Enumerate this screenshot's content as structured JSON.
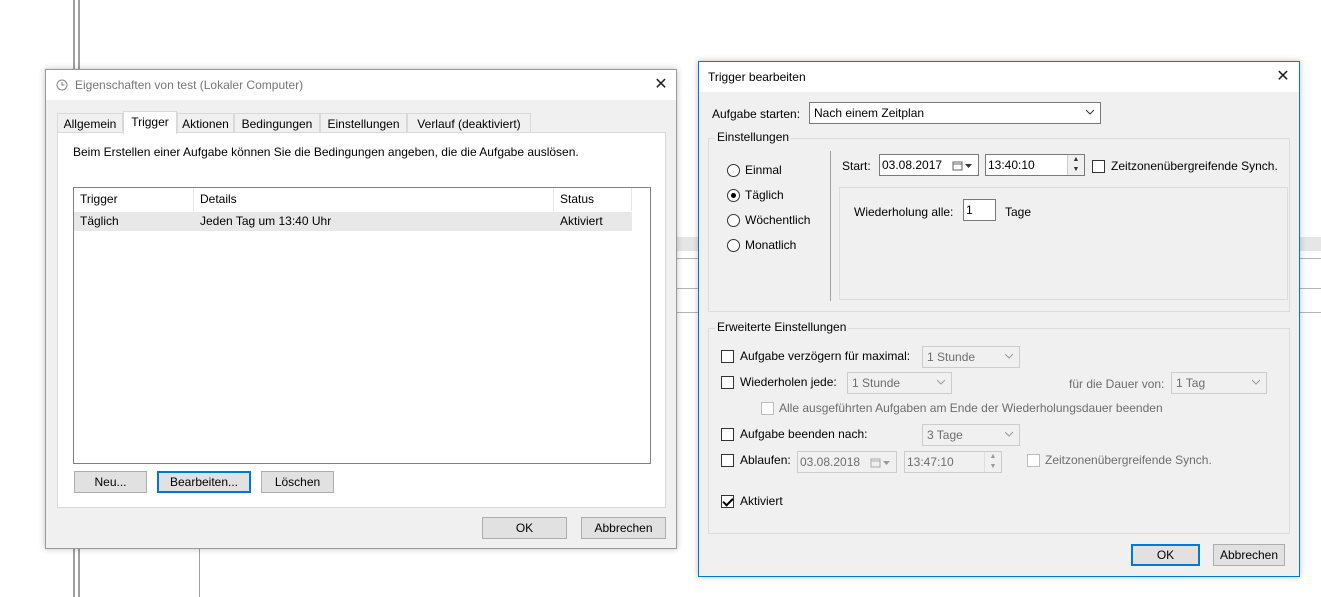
{
  "props_dialog": {
    "title": "Eigenschaften von test (Lokaler Computer)",
    "tabs": [
      "Allgemein",
      "Trigger",
      "Aktionen",
      "Bedingungen",
      "Einstellungen",
      "Verlauf (deaktiviert)"
    ],
    "active_tab": "Trigger",
    "description": "Beim Erstellen einer Aufgabe können Sie die Bedingungen angeben, die die Aufgabe auslösen.",
    "table": {
      "columns": [
        "Trigger",
        "Details",
        "Status"
      ],
      "rows": [
        {
          "trigger": "Täglich",
          "details": "Jeden Tag um 13:40 Uhr",
          "status": "Aktiviert"
        }
      ]
    },
    "buttons": {
      "new": "Neu...",
      "edit": "Bearbeiten...",
      "delete": "Löschen",
      "ok": "OK",
      "cancel": "Abbrechen"
    }
  },
  "trigger_dialog": {
    "title": "Trigger bearbeiten",
    "start_task_label": "Aufgabe starten:",
    "start_task_value": "Nach einem Zeitplan",
    "settings_group": "Einstellungen",
    "radios": [
      "Einmal",
      "Täglich",
      "Wöchentlich",
      "Monatlich"
    ],
    "selected_radio": "Täglich",
    "start_label": "Start:",
    "start_date": "03.08.2017",
    "start_time": "13:40:10",
    "sync_timezones": "Zeitzonenübergreifende Synch.",
    "repeat_label": "Wiederholung alle:",
    "repeat_value": "1",
    "repeat_unit": "Tage",
    "advanced_group": "Erweiterte Einstellungen",
    "delay_label": "Aufgabe verzögern für maximal:",
    "delay_value": "1 Stunde",
    "repeat_every_label": "Wiederholen jede:",
    "repeat_every_value": "1 Stunde",
    "duration_label": "für die Dauer von:",
    "duration_value": "1 Tag",
    "stop_all_label": "Alle ausgeführten Aufgaben am Ende der Wiederholungsdauer beenden",
    "stop_after_label": "Aufgabe beenden nach:",
    "stop_after_value": "3 Tage",
    "expire_label": "Ablaufen:",
    "expire_date": "03.08.2018",
    "expire_time": "13:47:10",
    "expire_sync": "Zeitzonenübergreifende Synch.",
    "enabled_label": "Aktiviert",
    "ok": "OK",
    "cancel": "Abbrechen"
  }
}
